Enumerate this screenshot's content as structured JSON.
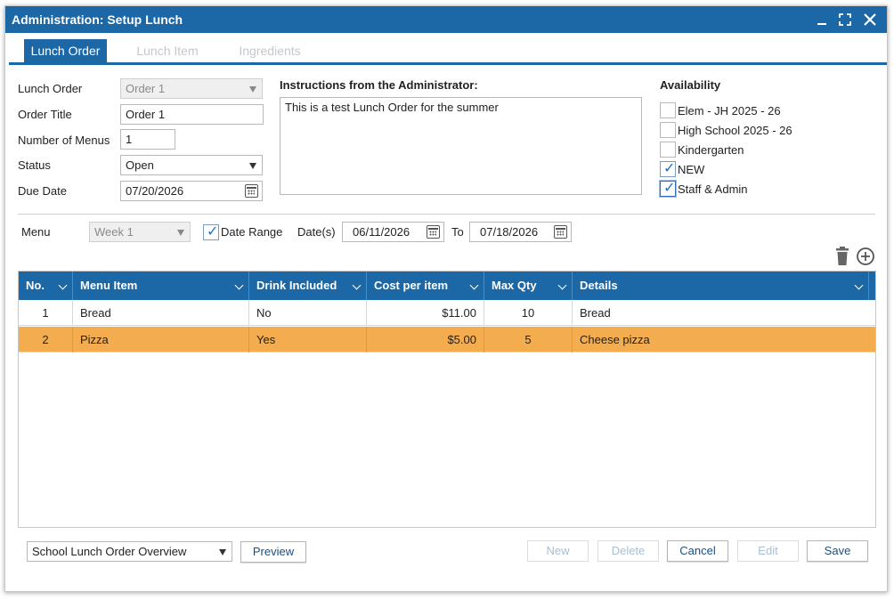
{
  "window": {
    "title": "Administration: Setup Lunch"
  },
  "tabs": [
    {
      "label": "Lunch Order",
      "active": true
    },
    {
      "label": "Lunch Item",
      "active": false
    },
    {
      "label": "Ingredients",
      "active": false
    }
  ],
  "form": {
    "lunch_order": {
      "label": "Lunch Order",
      "value": "Order 1"
    },
    "order_title": {
      "label": "Order Title",
      "value": "Order 1"
    },
    "number_of_menus": {
      "label": "Number of Menus",
      "value": "1"
    },
    "status": {
      "label": "Status",
      "value": "Open"
    },
    "due_date": {
      "label": "Due Date",
      "value": "07/20/2026"
    }
  },
  "instructions": {
    "label": "Instructions from the Administrator:",
    "text": "This is a test Lunch Order for the summer"
  },
  "availability": {
    "label": "Availability",
    "items": [
      {
        "label": "Elem - JH 2025 - 26",
        "checked": false
      },
      {
        "label": "High School 2025 - 26",
        "checked": false
      },
      {
        "label": "Kindergarten",
        "checked": false
      },
      {
        "label": "NEW",
        "checked": true
      },
      {
        "label": "Staff & Admin",
        "checked": true
      }
    ]
  },
  "menu_bar": {
    "menu_label": "Menu",
    "menu_value": "Week 1",
    "date_range_label": "Date Range",
    "date_range_checked": true,
    "dates_label": "Date(s)",
    "date_from": "06/11/2026",
    "to_label": "To",
    "date_to": "07/18/2026"
  },
  "grid": {
    "columns": [
      "No.",
      "Menu Item",
      "Drink Included",
      "Cost per item",
      "Max Qty",
      "Details"
    ],
    "rows": [
      {
        "no": "1",
        "item": "Bread",
        "drink": "No",
        "cost": "$11.00",
        "qty": "10",
        "details": "Bread",
        "selected": false
      },
      {
        "no": "2",
        "item": "Pizza",
        "drink": "Yes",
        "cost": "$5.00",
        "qty": "5",
        "details": "Cheese pizza",
        "selected": true
      }
    ]
  },
  "footer": {
    "report_select": "School Lunch Order Overview",
    "preview": "Preview",
    "new": "New",
    "delete": "Delete",
    "cancel": "Cancel",
    "edit": "Edit",
    "save": "Save"
  },
  "colors": {
    "header_blue": "#1c68a6",
    "selected_row": "#f3ad4f",
    "check_blue": "#1e6fc2"
  }
}
